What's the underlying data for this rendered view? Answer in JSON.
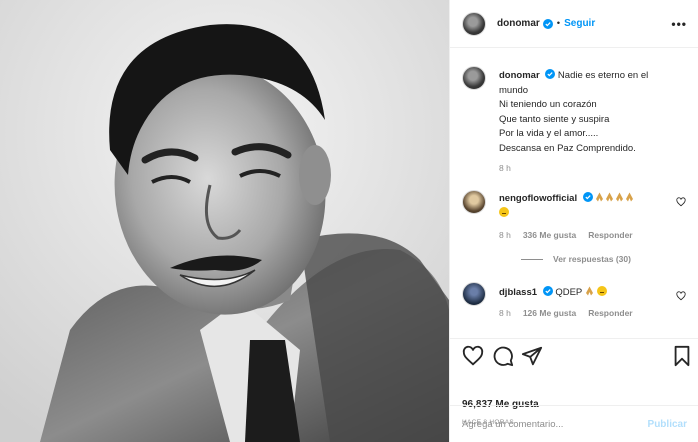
{
  "post": {
    "author": "donomar",
    "follow_label": "Seguir",
    "more_label": "•••",
    "separator": "•"
  },
  "caption": {
    "author": "donomar",
    "text": "Nadie es eterno en el mundo\nNi teniendo un corazón\nQue tanto siente y suspira\nPor la vida y el amor.....\nDescansa en Paz Comprendido.",
    "time": "8 h"
  },
  "comments": [
    {
      "author": "nengoflowofficial",
      "time": "8 h",
      "likes": "336 Me gusta",
      "reply_label": "Responder",
      "view_replies": "Ver respuestas (30)"
    },
    {
      "author": "djblass1",
      "text": "QDEP",
      "time": "8 h",
      "likes": "126 Me gusta",
      "reply_label": "Responder"
    }
  ],
  "actions": {
    "likes_count": "96,837 Me gusta",
    "posted_ago": "HACE 8 HORAS"
  },
  "composer": {
    "placeholder": "Agrega un comentario...",
    "publish_label": "Publicar"
  },
  "colors": {
    "accent": "#0095f6",
    "muted": "#8e8e8e",
    "publish_disabled": "#b2dffc",
    "border": "#efefef"
  },
  "icons": [
    "verified-badge-icon",
    "heart-icon",
    "comment-icon",
    "share-icon",
    "bookmark-icon",
    "praying-hands-icon",
    "smiley-emoji-icon"
  ]
}
